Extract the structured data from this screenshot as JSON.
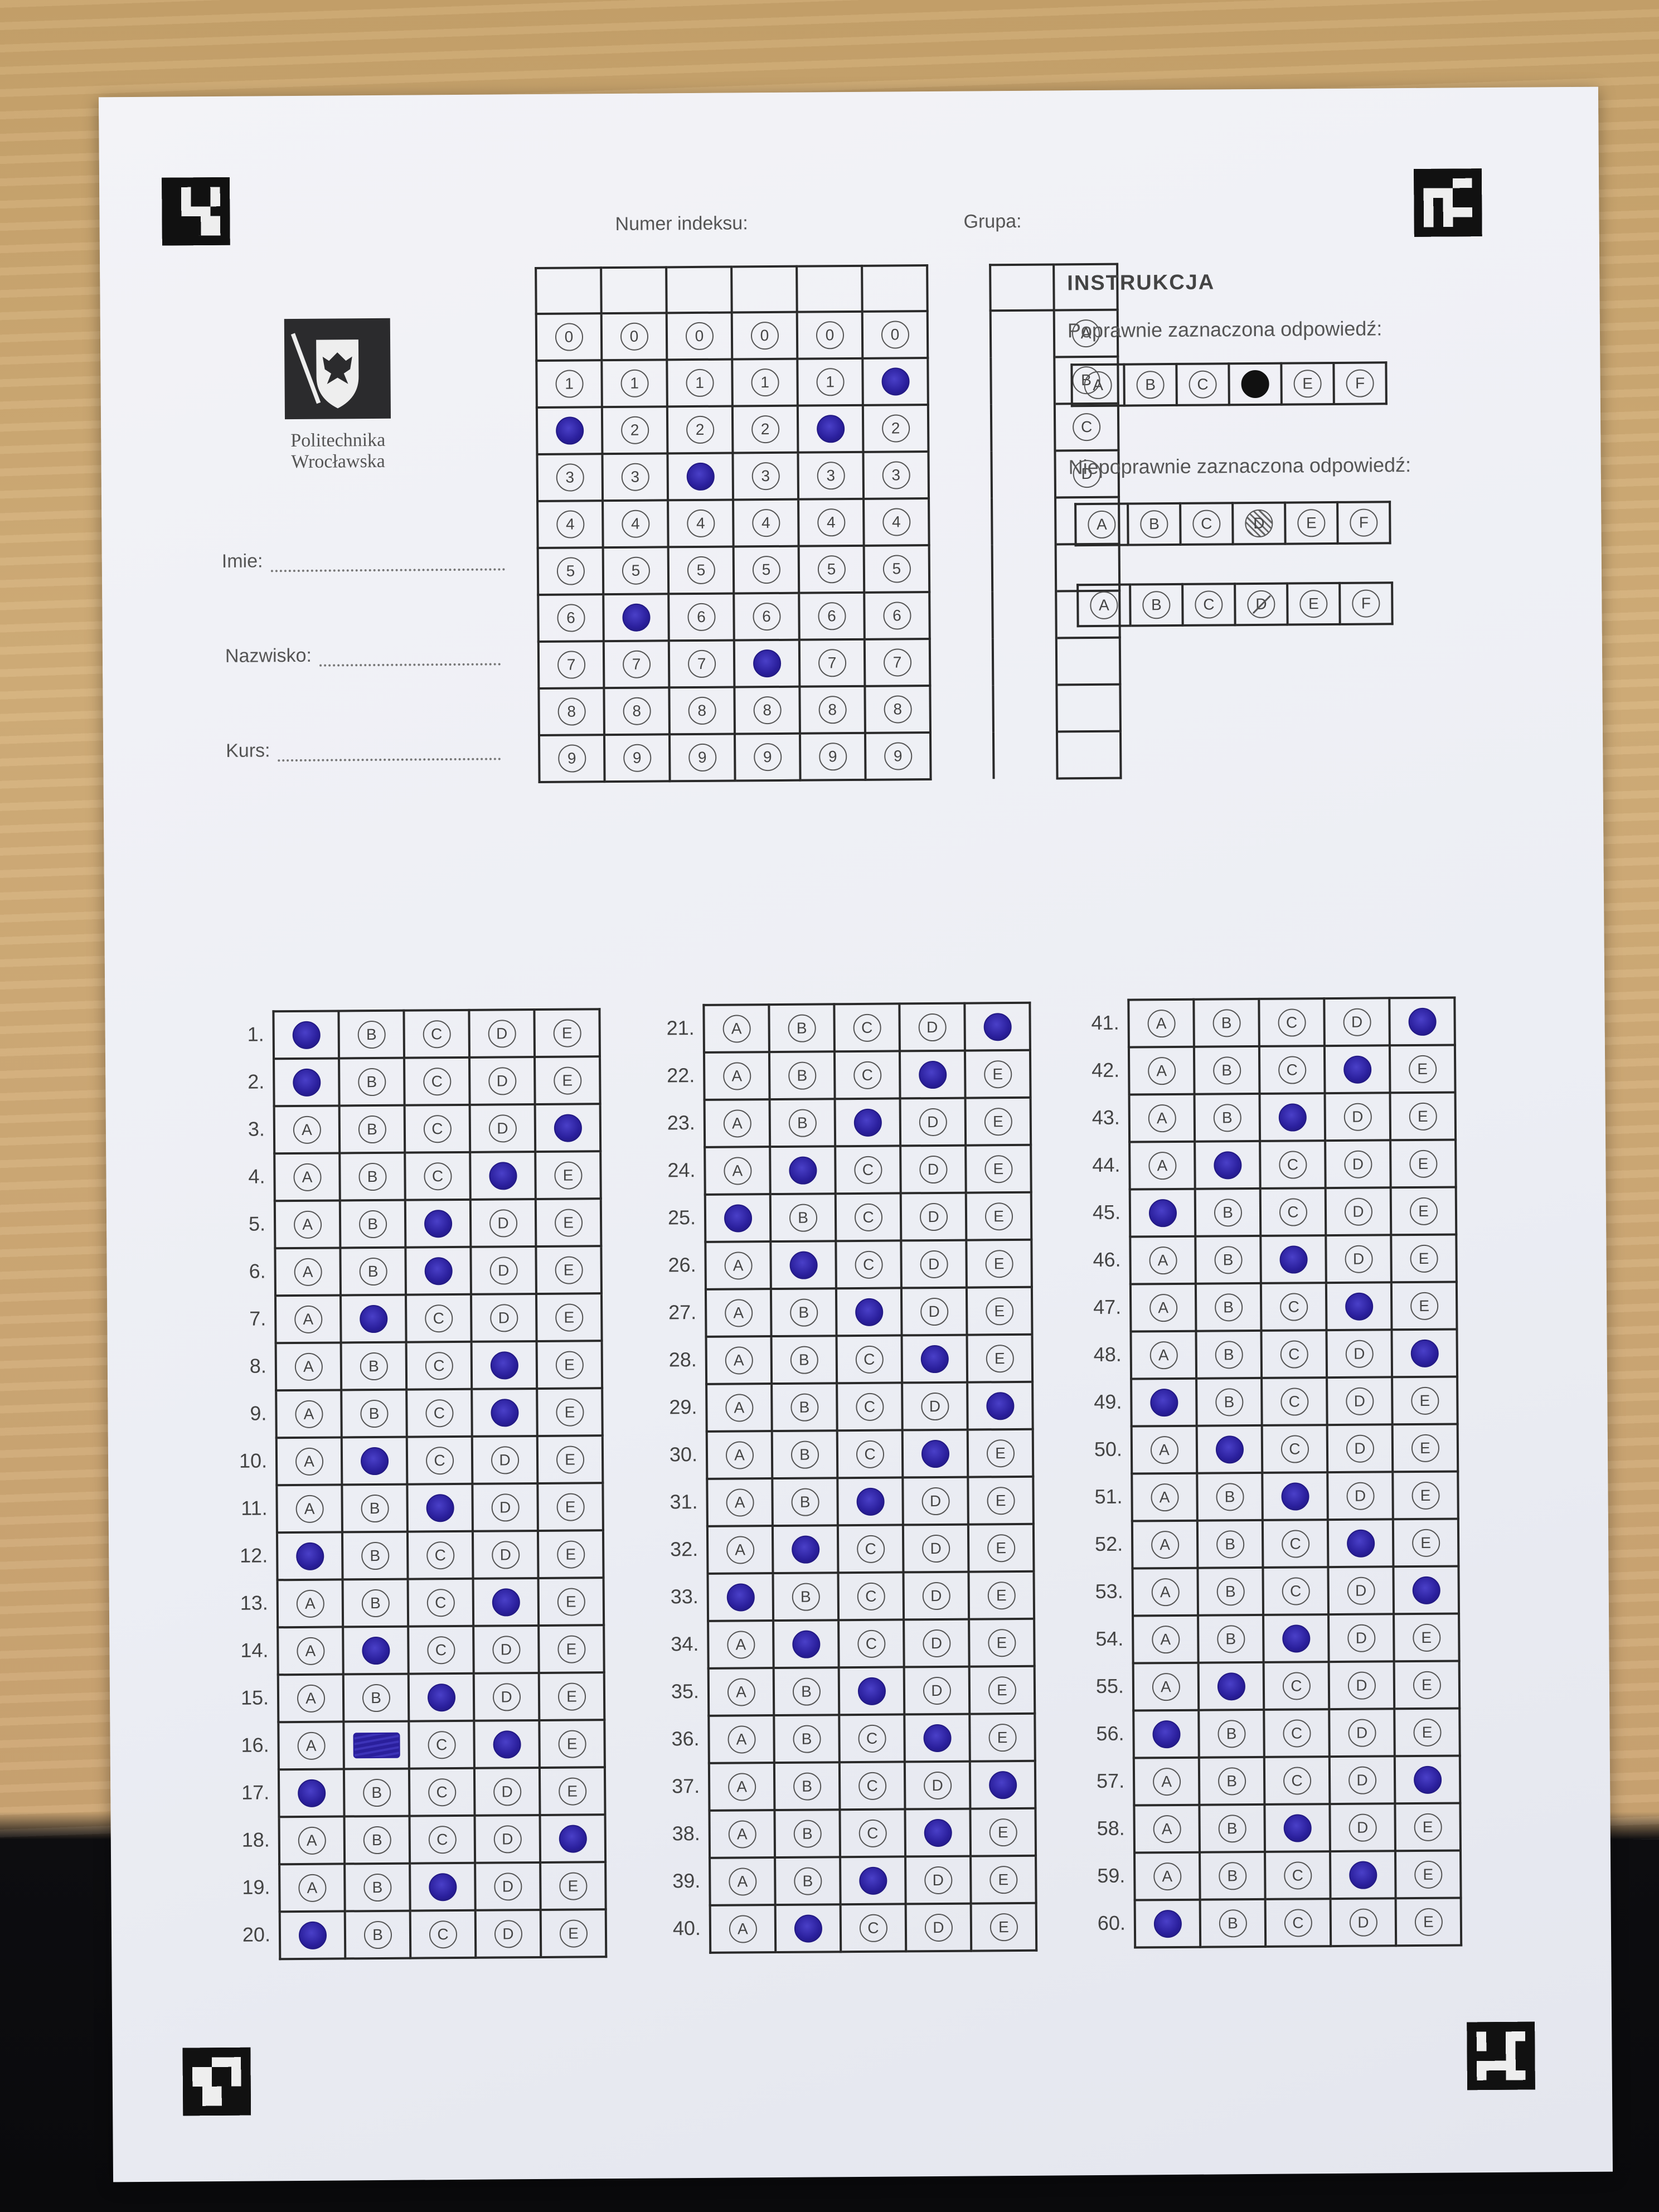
{
  "header": {
    "index_label": "Numer indeksu:",
    "group_label": "Grupa:"
  },
  "logo": {
    "name_line1": "Politechnika",
    "name_line2": "Wrocławska"
  },
  "fields": {
    "first_name": "Imie:",
    "last_name": "Nazwisko:",
    "course": "Kurs:"
  },
  "index_grid": {
    "digits": [
      "0",
      "1",
      "2",
      "3",
      "4",
      "5",
      "6",
      "7",
      "8",
      "9"
    ],
    "filled_digit_per_column": [
      2,
      6,
      3,
      7,
      2,
      1
    ]
  },
  "group_options": [
    "A",
    "B",
    "C",
    "D"
  ],
  "instructions": {
    "title": "INSTRUKCJA",
    "correct_label": "Poprawnie zaznaczona odpowiedź:",
    "incorrect_label": "Niepoprawnie zaznaczona odpowiedź:",
    "example_options": [
      "A",
      "B",
      "C",
      "D",
      "E",
      "F"
    ]
  },
  "answer_options": [
    "A",
    "B",
    "C",
    "D",
    "E"
  ],
  "answers": {
    "1": "A",
    "2": "A",
    "3": "E",
    "4": "D",
    "5": "C",
    "6": "C",
    "7": "B",
    "8": "D",
    "9": "D",
    "10": "B",
    "11": "C",
    "12": "A",
    "13": "D",
    "14": "B",
    "15": "C",
    "16": "D",
    "17": "A",
    "18": "E",
    "19": "C",
    "20": "A",
    "21": "E",
    "22": "D",
    "23": "C",
    "24": "B",
    "25": "A",
    "26": "B",
    "27": "C",
    "28": "D",
    "29": "E",
    "30": "D",
    "31": "C",
    "32": "B",
    "33": "A",
    "34": "B",
    "35": "C",
    "36": "D",
    "37": "E",
    "38": "D",
    "39": "C",
    "40": "B",
    "41": "E",
    "42": "D",
    "43": "C",
    "44": "B",
    "45": "A",
    "46": "C",
    "47": "D",
    "48": "E",
    "49": "A",
    "50": "B",
    "51": "C",
    "52": "D",
    "53": "E",
    "54": "C",
    "55": "B",
    "56": "A",
    "57": "E",
    "58": "C",
    "59": "D",
    "60": "A"
  },
  "scribbled": {
    "16": "B"
  },
  "colors": {
    "ink": "#2a1f9c",
    "paper": "#eceef4",
    "grid": "#2a2a2a"
  }
}
